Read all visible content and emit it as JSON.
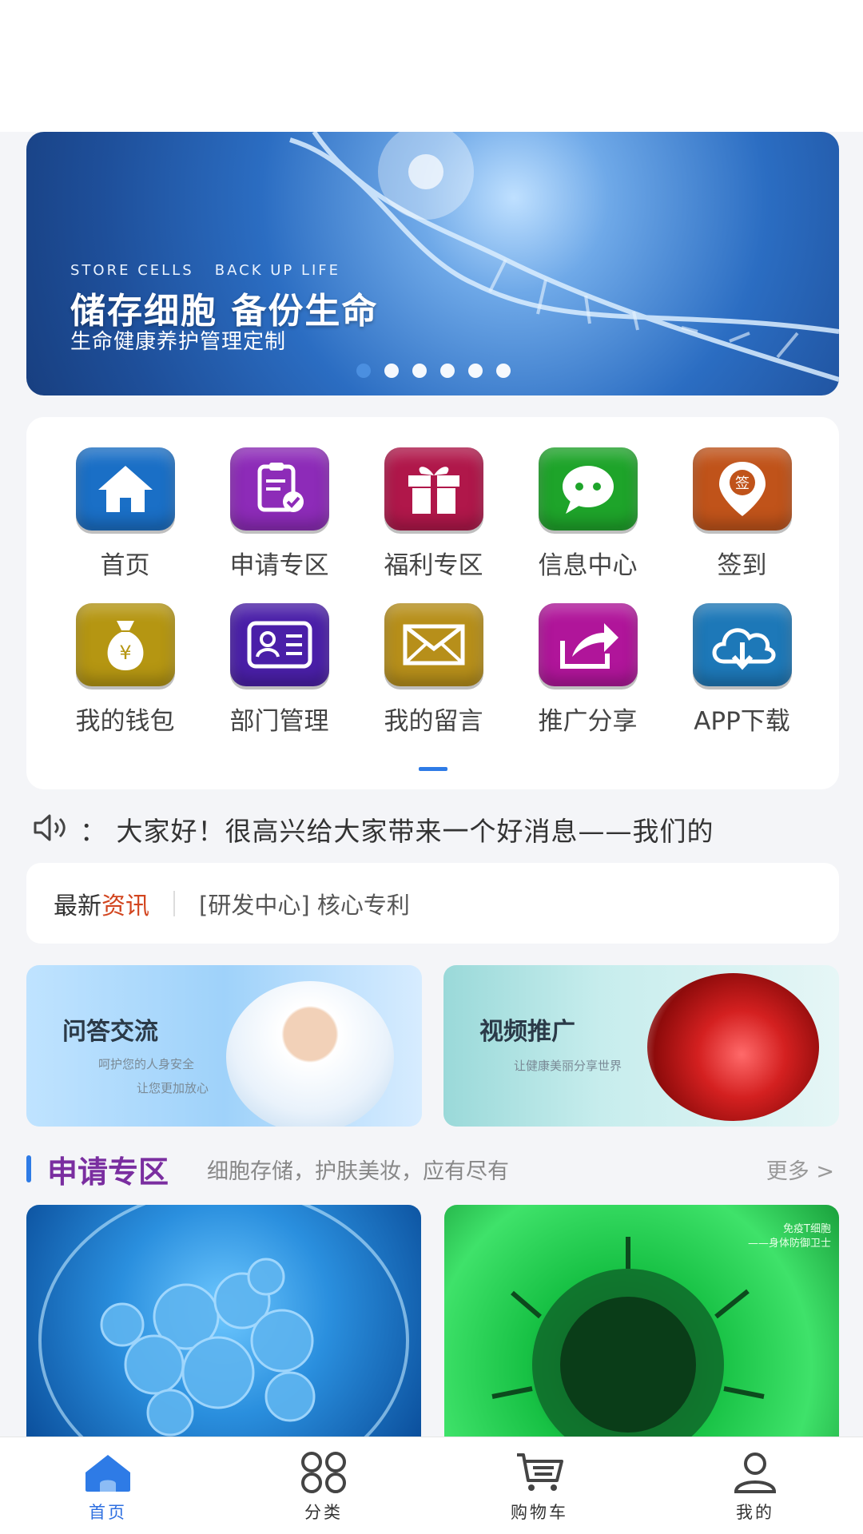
{
  "banner": {
    "en_line": "STORE CELLS   BACK UP LIFE",
    "title": "储存细胞 备份生命",
    "subtitle": "生命健康养护管理定制",
    "dot_count": 6,
    "active_dot": 0
  },
  "grid": [
    {
      "label": "首页",
      "icon": "house-icon",
      "color": "#1a6fc6"
    },
    {
      "label": "申请专区",
      "icon": "clipboard-check-icon",
      "color": "#8d2bb8"
    },
    {
      "label": "福利专区",
      "icon": "gift-icon",
      "color": "#b0174a"
    },
    {
      "label": "信息中心",
      "icon": "chat-bubble-icon",
      "color": "#1ea42a"
    },
    {
      "label": "签到",
      "icon": "sign-in-pin-icon",
      "badge": "签",
      "color": "#c0531a"
    },
    {
      "label": "我的钱包",
      "icon": "money-bag-icon",
      "badge": "¥",
      "color": "#b59612"
    },
    {
      "label": "部门管理",
      "icon": "id-card-icon",
      "color": "#4a1fa8"
    },
    {
      "label": "我的留言",
      "icon": "envelope-icon",
      "color": "#b78f1a"
    },
    {
      "label": "推广分享",
      "icon": "share-arrow-icon",
      "color": "#b0159a"
    },
    {
      "label": "APP下载",
      "icon": "cloud-download-icon",
      "color": "#1d78b8"
    }
  ],
  "notice": {
    "icon": "speaker-icon",
    "text": "：  大家好！很高兴给大家带来一个好消息——我们的"
  },
  "news": {
    "tag_prefix": "最新",
    "tag_highlight": "资讯",
    "text": "[研发中心] 核心专利"
  },
  "promos": [
    {
      "title": "问答交流",
      "sub1": "呵护您的人身安全",
      "sub2": "让您更加放心"
    },
    {
      "title": "视频推广",
      "sub1": "让健康美丽分享世界"
    }
  ],
  "section": {
    "title": "申请专区",
    "subtitle": "细胞存储，护肤美妆，应有尽有",
    "more": "更多 >"
  },
  "products": [
    {
      "caption_lines": []
    },
    {
      "caption_lines": [
        "免疫T细胞",
        "——身体防御卫士"
      ]
    }
  ],
  "tabs": [
    {
      "label": "首页",
      "icon": "home-icon",
      "active": true
    },
    {
      "label": "分类",
      "icon": "grid-icon",
      "active": false
    },
    {
      "label": "购物车",
      "icon": "cart-icon",
      "active": false
    },
    {
      "label": "我的",
      "icon": "user-icon",
      "active": false
    }
  ],
  "colors": {
    "accent": "#2e7be6",
    "section_title": "#7a2ea0",
    "news_highlight": "#d2451f"
  }
}
